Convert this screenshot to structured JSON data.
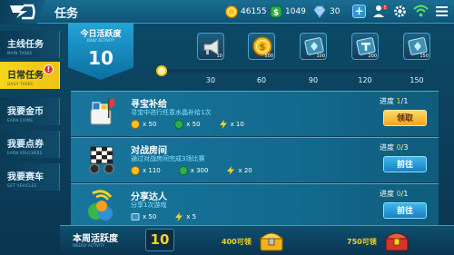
{
  "header": {
    "title": "任务",
    "coins": "46155",
    "gems": "1049",
    "diamonds": "30"
  },
  "sidebar": {
    "items": [
      {
        "label": "主线任务",
        "sub": "MAIN TASKS"
      },
      {
        "label": "日常任务",
        "sub": "DAILY TASKS",
        "active": true,
        "alert": "!"
      },
      {
        "label": "我要金币",
        "sub": "EARN COINS"
      },
      {
        "label": "我要点券",
        "sub": "EARN VOUCHERS"
      },
      {
        "label": "我要赛车",
        "sub": "GET VEHICLES"
      }
    ]
  },
  "daily": {
    "title": "今日活跃度",
    "sub": "DAILY ACTIVITY",
    "value": "10",
    "progress_fraction": 0.0,
    "milestones": [
      "30",
      "60",
      "90",
      "120",
      "150"
    ],
    "rewards": [
      {
        "icon": "megaphone-icon",
        "count": "10"
      },
      {
        "icon": "gold-coin-icon",
        "count": "500"
      },
      {
        "icon": "gem-card-icon",
        "count": "100"
      },
      {
        "icon": "t-card-icon",
        "count": "200"
      },
      {
        "icon": "gem-card-icon",
        "count": "150"
      }
    ]
  },
  "tasks": [
    {
      "name": "寻宝补给",
      "desc": "寻宝中进行任意水晶补给1次",
      "rewards": [
        "x 50",
        "x 50",
        "x 10"
      ],
      "progress_cur": "1",
      "progress_total": "1",
      "progress_label": "进度",
      "button": "领取",
      "button_type": "claim"
    },
    {
      "name": "对战房间",
      "desc": "通过对战房间完成3场比赛",
      "rewards": [
        "x 110",
        "x 300",
        "x 20"
      ],
      "progress_cur": "0",
      "progress_total": "3",
      "progress_label": "进度",
      "button": "前往",
      "button_type": "go"
    },
    {
      "name": "分享达人",
      "desc": "分享1次游戏",
      "rewards": [
        "x 50",
        "x 5"
      ],
      "progress_cur": "0",
      "progress_total": "1",
      "progress_label": "进度",
      "button": "前往",
      "button_type": "go"
    }
  ],
  "weekly": {
    "title": "本周活跃度",
    "sub": "WEEKLY ACTIVITY",
    "value": "10",
    "chest1_label": "400可领",
    "chest2_label": "750可领"
  },
  "colors": {
    "accent_yellow": "#f6d324",
    "panel_blue": "#18759b",
    "text_cyan": "#8ce7ff"
  }
}
